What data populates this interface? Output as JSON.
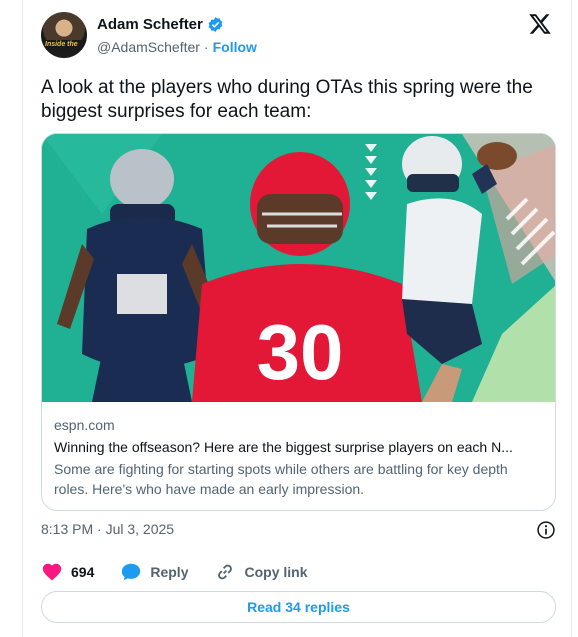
{
  "author": {
    "name": "Adam Schefter",
    "handle": "@AdamSchefter",
    "separator": "·",
    "follow_label": "Follow",
    "avatar_text": "Inside the"
  },
  "tweet": {
    "text": "A look at the players who during OTAs this spring were the biggest surprises for each team:"
  },
  "link_card": {
    "domain": "espn.com",
    "title": "Winning the offseason? Here are the biggest surprise players on each N...",
    "description": "Some are fighting for starting spots while others are battling for key depth roles. Here's who have made an early impression.",
    "jersey_number": "30"
  },
  "timestamp": "8:13 PM · Jul 3, 2025",
  "actions": {
    "likes_count": "694",
    "reply_label": "Reply",
    "copy_link_label": "Copy link"
  },
  "read_replies_label": "Read 34 replies",
  "colors": {
    "brand": "#1d9bf0",
    "like": "#f91880",
    "muted": "#536471",
    "media_background": "#1fa88c"
  }
}
